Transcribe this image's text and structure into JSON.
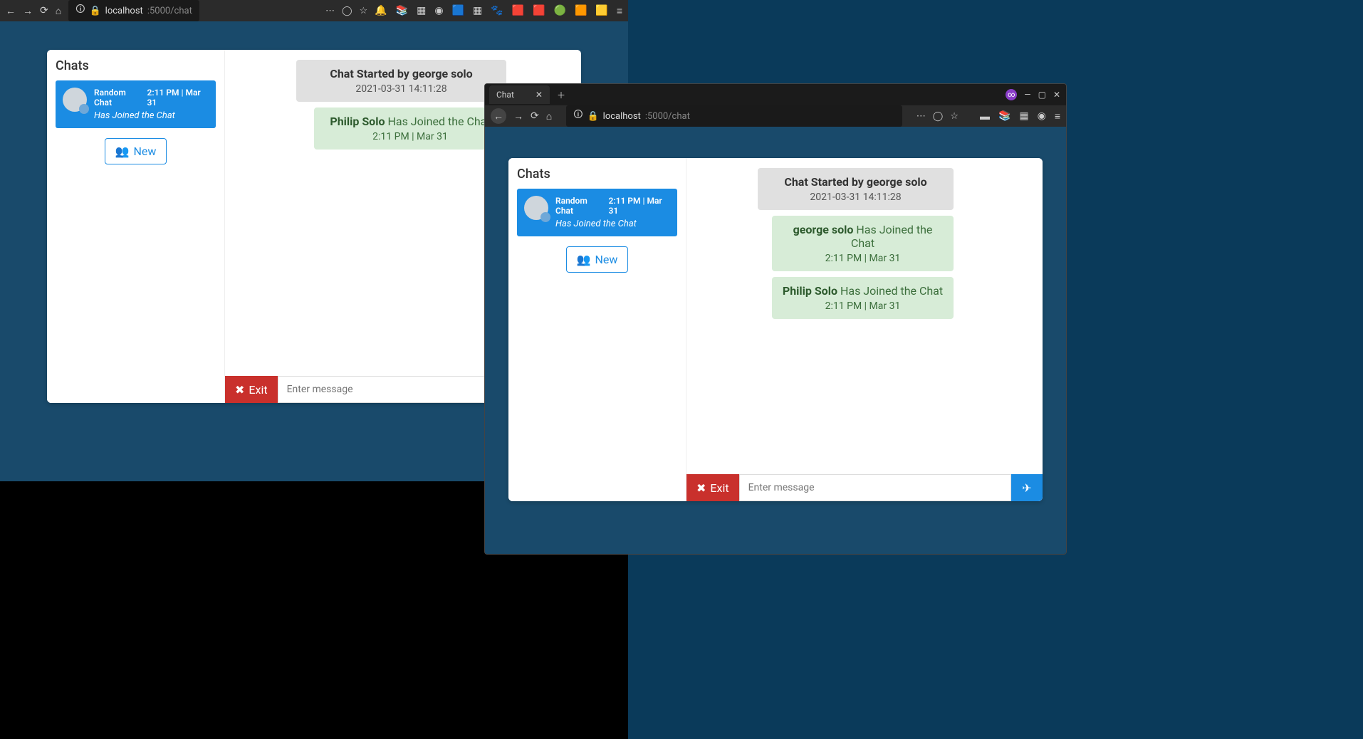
{
  "browser1": {
    "url_host": "localhost",
    "url_path": ":5000/chat"
  },
  "browser2": {
    "tab_title": "Chat",
    "url_host": "localhost",
    "url_path": ":5000/chat"
  },
  "app1": {
    "sidebar_title": "Chats",
    "chat_item": {
      "name": "Random Chat",
      "time": "2:11 PM | Mar 31",
      "joined_text": "Has Joined the Chat"
    },
    "new_btn": "New",
    "start": {
      "title": "Chat Started by george solo",
      "time": "2021-03-31 14:11:28"
    },
    "joins": [
      {
        "name": "Philip Solo",
        "text": "Has Joined the Chat",
        "time": "2:11 PM | Mar 31"
      }
    ],
    "exit_label": "Exit",
    "input_placeholder": "Enter message"
  },
  "app2": {
    "sidebar_title": "Chats",
    "chat_item": {
      "name": "Random Chat",
      "time": "2:11 PM | Mar 31",
      "joined_text": "Has Joined the Chat"
    },
    "new_btn": "New",
    "start": {
      "title": "Chat Started by george solo",
      "time": "2021-03-31 14:11:28"
    },
    "joins": [
      {
        "name": "george solo",
        "text": "Has Joined the Chat",
        "time": "2:11 PM | Mar 31"
      },
      {
        "name": "Philip Solo",
        "text": "Has Joined the Chat",
        "time": "2:11 PM | Mar 31"
      }
    ],
    "exit_label": "Exit",
    "input_placeholder": "Enter message"
  }
}
